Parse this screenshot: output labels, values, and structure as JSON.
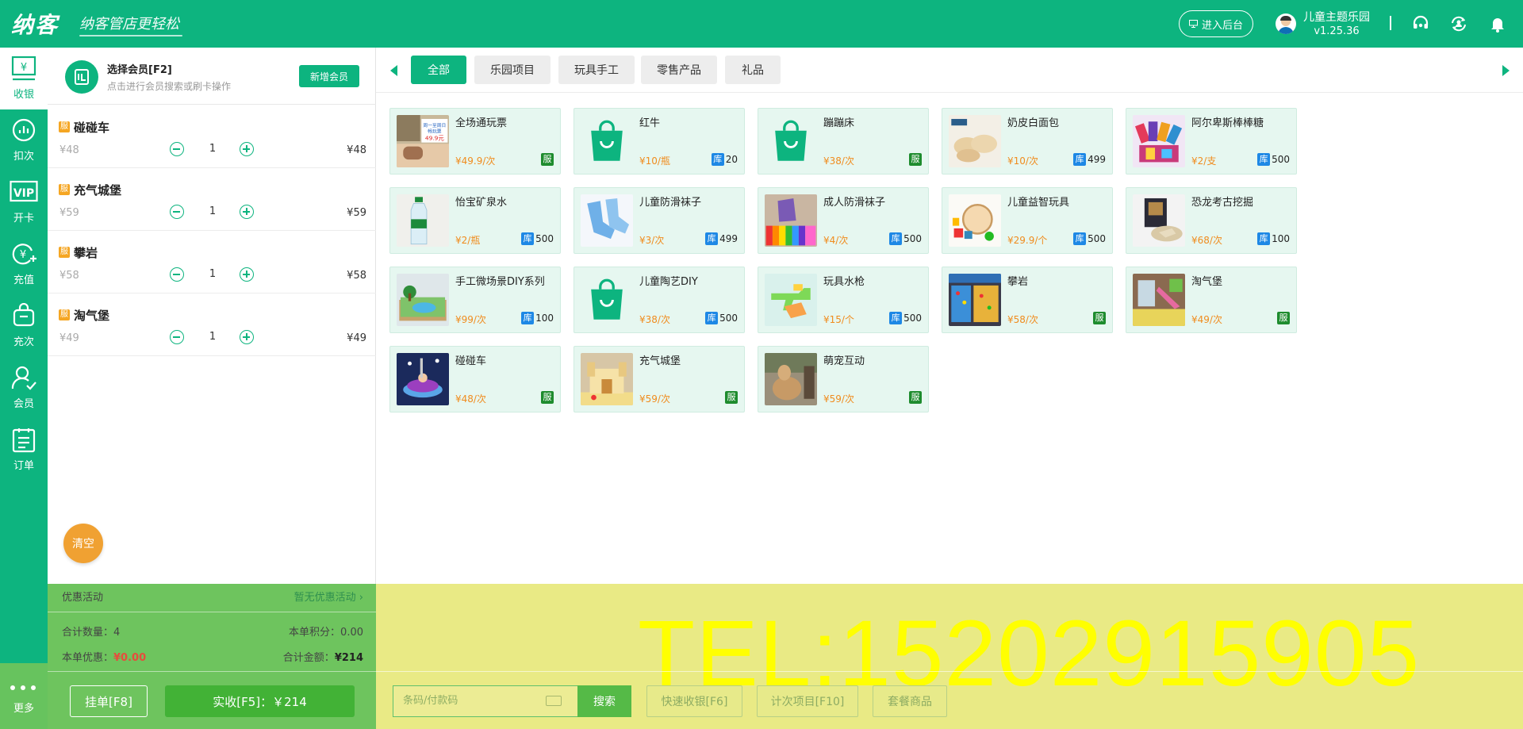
{
  "app": {
    "logo": "纳客",
    "slogan": "纳客管店更轻松",
    "admin_button": "进入后台",
    "store_name": "儿童主题乐园",
    "version": "v1.25.36"
  },
  "sidebar": {
    "items": [
      {
        "label": "收银",
        "icon": "cashier-icon"
      },
      {
        "label": "扣次",
        "icon": "chart-icon"
      },
      {
        "label": "开卡",
        "icon": "vip-card-icon"
      },
      {
        "label": "充值",
        "icon": "recharge-icon"
      },
      {
        "label": "充次",
        "icon": "bag-icon"
      },
      {
        "label": "会员",
        "icon": "member-icon"
      },
      {
        "label": "订单",
        "icon": "order-icon"
      }
    ],
    "more": "更多"
  },
  "member": {
    "title": "选择会员[F2]",
    "subtitle": "点击进行会员搜索或刷卡操作",
    "new_button": "新增会员"
  },
  "cart": {
    "tag": "服",
    "items": [
      {
        "name": "碰碰车",
        "unit_price": "¥48",
        "qty": "1",
        "total": "¥48"
      },
      {
        "name": "充气城堡",
        "unit_price": "¥59",
        "qty": "1",
        "total": "¥59"
      },
      {
        "name": "攀岩",
        "unit_price": "¥58",
        "qty": "1",
        "total": "¥58"
      },
      {
        "name": "淘气堡",
        "unit_price": "¥49",
        "qty": "1",
        "total": "¥49"
      }
    ],
    "clear_button": "清空"
  },
  "summary": {
    "promo_label": "优惠活动",
    "promo_value": "暂无优惠活动 ›",
    "count_label": "合计数量：",
    "count_value": "4",
    "points_label": "本单积分：",
    "points_value": "0.00",
    "discount_label": "本单优惠：",
    "discount_value": "¥0.00",
    "amount_label": "合计金额：",
    "amount_value": "¥214",
    "hang_button": "挂单[F8]",
    "pay_button": "实收[F5]：￥214"
  },
  "tabs": [
    "全部",
    "乐园项目",
    "玩具手工",
    "零售产品",
    "礼品"
  ],
  "products": [
    {
      "name": "全场通玩票",
      "price": "¥49.9/次",
      "tag": "服",
      "stock": "",
      "img": "ticket"
    },
    {
      "name": "红牛",
      "price": "¥10/瓶",
      "tag": "库",
      "stock": "20",
      "img": "bag"
    },
    {
      "name": "蹦蹦床",
      "price": "¥38/次",
      "tag": "服",
      "stock": "",
      "img": "bag"
    },
    {
      "name": "奶皮白面包",
      "price": "¥10/次",
      "tag": "库",
      "stock": "499",
      "img": "bread"
    },
    {
      "name": "阿尔卑斯棒棒糖",
      "price": "¥2/支",
      "tag": "库",
      "stock": "500",
      "img": "candy"
    },
    {
      "name": "怡宝矿泉水",
      "price": "¥2/瓶",
      "tag": "库",
      "stock": "500",
      "img": "water"
    },
    {
      "name": "儿童防滑袜子",
      "price": "¥3/次",
      "tag": "库",
      "stock": "499",
      "img": "socks"
    },
    {
      "name": "成人防滑袜子",
      "price": "¥4/次",
      "tag": "库",
      "stock": "500",
      "img": "colorsocks"
    },
    {
      "name": "儿童益智玩具",
      "price": "¥29.9/个",
      "tag": "库",
      "stock": "500",
      "img": "toy"
    },
    {
      "name": "恐龙考古挖掘",
      "price": "¥68/次",
      "tag": "库",
      "stock": "100",
      "img": "dino"
    },
    {
      "name": "手工微场景DIY系列",
      "price": "¥99/次",
      "tag": "库",
      "stock": "100",
      "img": "diorama"
    },
    {
      "name": "儿童陶艺DIY",
      "price": "¥38/次",
      "tag": "库",
      "stock": "500",
      "img": "bag"
    },
    {
      "name": "玩具水枪",
      "price": "¥15/个",
      "tag": "库",
      "stock": "500",
      "img": "watergun"
    },
    {
      "name": "攀岩",
      "price": "¥58/次",
      "tag": "服",
      "stock": "",
      "img": "climb"
    },
    {
      "name": "淘气堡",
      "price": "¥49/次",
      "tag": "服",
      "stock": "",
      "img": "playground"
    },
    {
      "name": "碰碰车",
      "price": "¥48/次",
      "tag": "服",
      "stock": "",
      "img": "bumper"
    },
    {
      "name": "充气城堡",
      "price": "¥59/次",
      "tag": "服",
      "stock": "",
      "img": "castle"
    },
    {
      "name": "萌宠互动",
      "price": "¥59/次",
      "tag": "服",
      "stock": "",
      "img": "alpaca"
    }
  ],
  "bottom": {
    "search_placeholder": "条码/付款码",
    "search_button": "搜索",
    "quick_button": "快速收银[F6]",
    "count_button": "计次项目[F10]",
    "package_button": "套餐商品"
  },
  "watermark": "TEL:15202915905",
  "colors": {
    "brand": "#0db47f",
    "price": "#f08c1e",
    "service_tag": "#1e8c2e",
    "stock_tag": "#1e88e5",
    "cart_tag": "#f5a623"
  }
}
